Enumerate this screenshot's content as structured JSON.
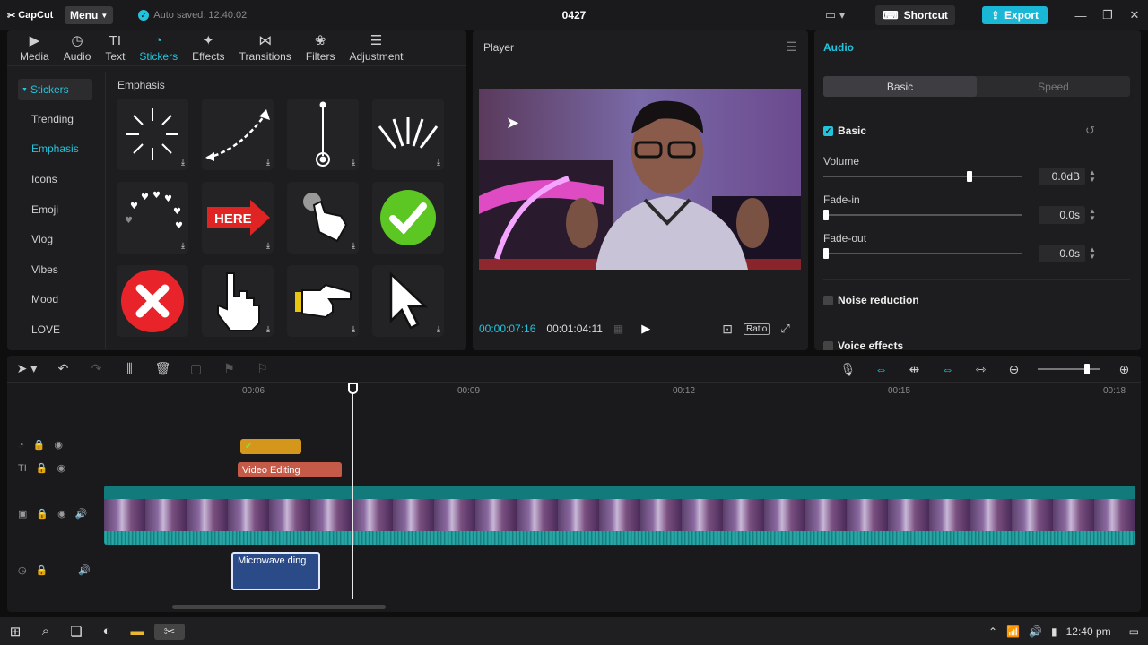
{
  "app": {
    "logo_text": "CapCut",
    "menu_label": "Menu",
    "autosave_text": "Auto saved: 12:40:02",
    "project_title": "0427",
    "shortcut_label": "Shortcut",
    "export_label": "Export",
    "accent_color": "#22c4dd"
  },
  "media_tabs": [
    {
      "label": "Media",
      "icon": "media-icon"
    },
    {
      "label": "Audio",
      "icon": "audio-icon"
    },
    {
      "label": "Text",
      "icon": "text-icon"
    },
    {
      "label": "Stickers",
      "icon": "stickers-icon",
      "active": true
    },
    {
      "label": "Effects",
      "icon": "effects-icon"
    },
    {
      "label": "Transitions",
      "icon": "transitions-icon"
    },
    {
      "label": "Filters",
      "icon": "filters-icon"
    },
    {
      "label": "Adjustment",
      "icon": "adjustment-icon"
    }
  ],
  "sticker_nav": {
    "header": "Stickers",
    "items": [
      "Trending",
      "Emphasis",
      "Icons",
      "Emoji",
      "Vlog",
      "Vibes",
      "Mood",
      "LOVE"
    ],
    "active": "Emphasis"
  },
  "sticker_section": {
    "title": "Emphasis",
    "stickers": [
      "burst-arrows-sticker",
      "curved-arrow-sticker",
      "pin-line-sticker",
      "splash-arrows-sticker",
      "hearts-arc-sticker",
      "here-arrow-sticker",
      "tap-hand-sticker",
      "green-check-sticker",
      "red-x-sticker",
      "pointer-hand-sticker",
      "pointing-hand-sticker",
      "cursor-arrow-sticker"
    ],
    "here_text": "HERE"
  },
  "player": {
    "title": "Player",
    "current_time": "00:00:07:16",
    "total_time": "00:01:04:11",
    "ratio_label": "Ratio"
  },
  "audio_panel": {
    "title": "Audio",
    "tabs": [
      "Basic",
      "Speed"
    ],
    "active_tab": "Basic",
    "basic_label": "Basic",
    "basic_checked": true,
    "volume_label": "Volume",
    "volume_value": "0.0dB",
    "volume_level": 0.74,
    "fadein_label": "Fade-in",
    "fadein_value": "0.0s",
    "fadein_level": 0,
    "fadeout_label": "Fade-out",
    "fadeout_value": "0.0s",
    "fadeout_level": 0,
    "noise_label": "Noise reduction",
    "noise_checked": false,
    "voice_label": "Voice effects",
    "voice_checked": false
  },
  "timeline": {
    "ruler_labels": [
      "00:06",
      "00:09",
      "00:12",
      "00:15",
      "00:18"
    ],
    "text_clip": "Video Editing",
    "audio_clip": "Microwave ding",
    "zoom_level": 0.82
  },
  "taskbar": {
    "time": "12:40 pm"
  }
}
